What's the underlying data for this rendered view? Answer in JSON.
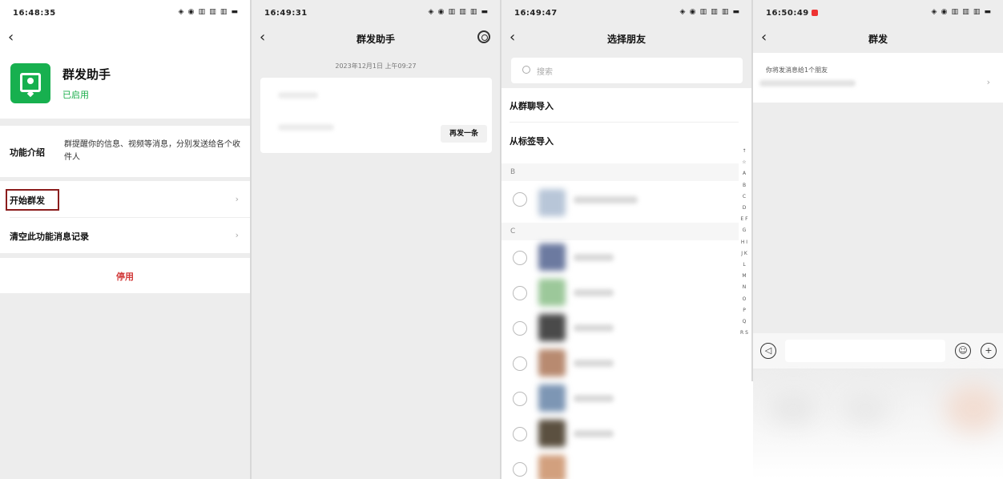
{
  "panel1": {
    "time": "16:48:35",
    "status_icons": "◈ ◉ ▥ ▥ ▥ ▬",
    "app_name": "群发助手",
    "app_status": "已启用",
    "intro_label": "功能介绍",
    "intro_text": "群提醒你的信息、视频等消息，分别发送给各个收件人",
    "start_label": "开始群发",
    "clear_label": "清空此功能消息记录",
    "disable_label": "停用"
  },
  "panel2": {
    "time": "16:49:31",
    "status_icons": "◈ ◉ ▥ ▥ ▥ ▬",
    "title": "群发助手",
    "timestamp": "2023年12月1日 上午09:27",
    "resend_label": "再发一条"
  },
  "panel3": {
    "time": "16:49:47",
    "status_icons": "◈ ◉ ▥ ▥ ▥ ▬",
    "title": "选择朋友",
    "search_placeholder": "搜索",
    "option_group": "从群聊导入",
    "option_tag": "从标签导入",
    "section_b": "B",
    "section_c": "C",
    "index_letters": "↑ ☆ A B C D E F G H I J K L M N O P Q R S"
  },
  "panel4": {
    "time": "16:50:49",
    "status_icons": "◈ ◉ ▥ ▥ ▥ ▬",
    "title": "群发",
    "recipients_text": "你将发消息给1个朋友"
  },
  "colors": {
    "wechat_green": "#17b04f",
    "danger_red": "#d23b3b",
    "highlight_border": "#8b1d1d",
    "background_gray": "#ededed"
  }
}
